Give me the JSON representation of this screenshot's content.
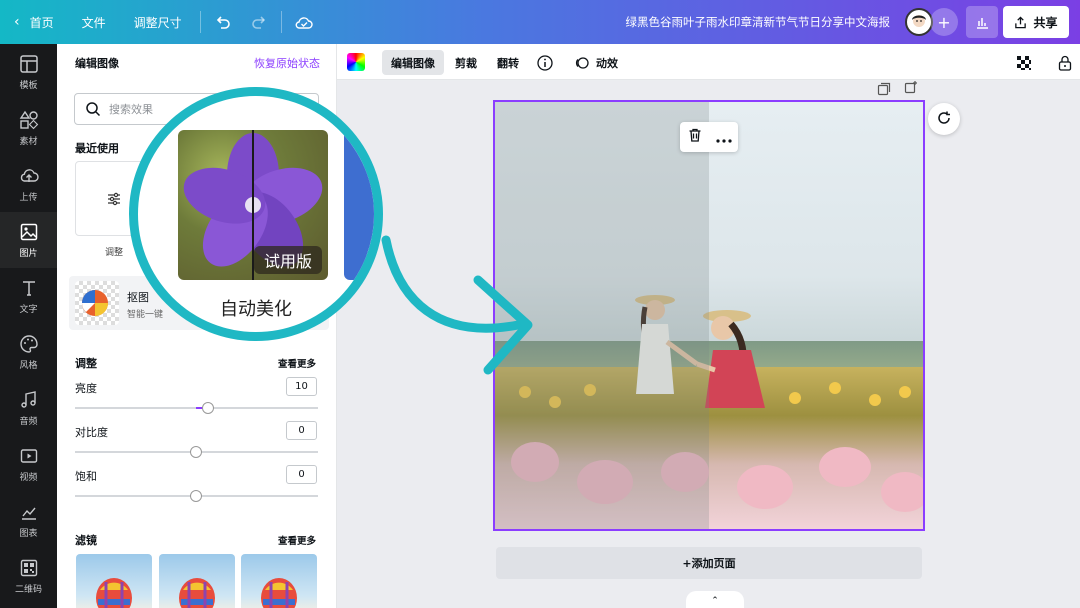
{
  "topbar": {
    "home": "首页",
    "file": "文件",
    "resize": "调整尺寸",
    "title": "绿黑色谷雨叶子雨水印章清新节气节日分享中文海报",
    "share": "共享"
  },
  "rail": [
    {
      "label": "模板",
      "icon": "template-icon"
    },
    {
      "label": "素材",
      "icon": "elements-icon"
    },
    {
      "label": "上传",
      "icon": "upload-icon"
    },
    {
      "label": "图片",
      "icon": "photo-icon"
    },
    {
      "label": "文字",
      "icon": "text-icon"
    },
    {
      "label": "风格",
      "icon": "palette-icon"
    },
    {
      "label": "音频",
      "icon": "music-icon"
    },
    {
      "label": "视频",
      "icon": "video-icon"
    },
    {
      "label": "图表",
      "icon": "chart-icon"
    },
    {
      "label": "二维码",
      "icon": "qrcode-icon"
    }
  ],
  "panel": {
    "header": "编辑图像",
    "reset": "恢复原始状态",
    "search_placeholder": "搜索效果",
    "recent": "最近使用",
    "adjust_card": "调整",
    "bg_remove_title": "抠图",
    "bg_remove_sub": "智能一键",
    "adjust_section": "调整",
    "see_more": "查看更多",
    "sliders": [
      {
        "label": "亮度",
        "value": "10",
        "level": 0.55
      },
      {
        "label": "对比度",
        "value": "0",
        "level": 0.5
      },
      {
        "label": "饱和",
        "value": "0",
        "level": 0.5
      }
    ],
    "filters_section": "滤镜",
    "filters_more": "查看更多"
  },
  "callout": {
    "badge": "试用版",
    "label": "自动美化"
  },
  "toolbar2": {
    "edit_image": "编辑图像",
    "crop": "剪裁",
    "flip": "翻转",
    "animate": "动效"
  },
  "canvas": {
    "add_page": "+添加页面"
  },
  "colors": {
    "accent": "#8b3dff",
    "teal": "#1fb8c4"
  }
}
